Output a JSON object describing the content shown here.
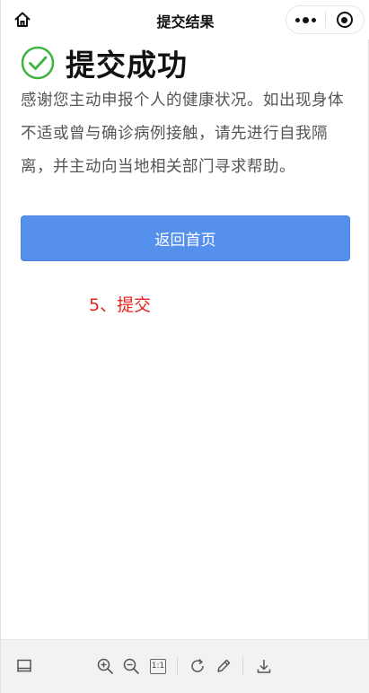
{
  "navbar": {
    "title": "提交结果",
    "home_icon": "home-icon",
    "more_icon": "more-dots-icon",
    "close_icon": "target-close-icon"
  },
  "result": {
    "title": "提交成功",
    "message": "感谢您主动申报个人的健康状况。如出现身体不适或曾与确诊病例接触，请先进行自我隔离，并主动向当地相关部门寻求帮助。",
    "check_icon": "check-circle-icon",
    "accent_color": "#3fb33f"
  },
  "actions": {
    "home_button_label": "返回首页",
    "button_color": "#5591ec"
  },
  "annotation": {
    "text": "5、提交",
    "color": "#e8211c"
  },
  "toolbar": {
    "items": [
      "layout-icon",
      "zoom-in-icon",
      "zoom-out-icon",
      "actual-size-icon",
      "rotate-icon",
      "pen-icon",
      "download-icon"
    ],
    "actual_size_label": "1:1"
  }
}
